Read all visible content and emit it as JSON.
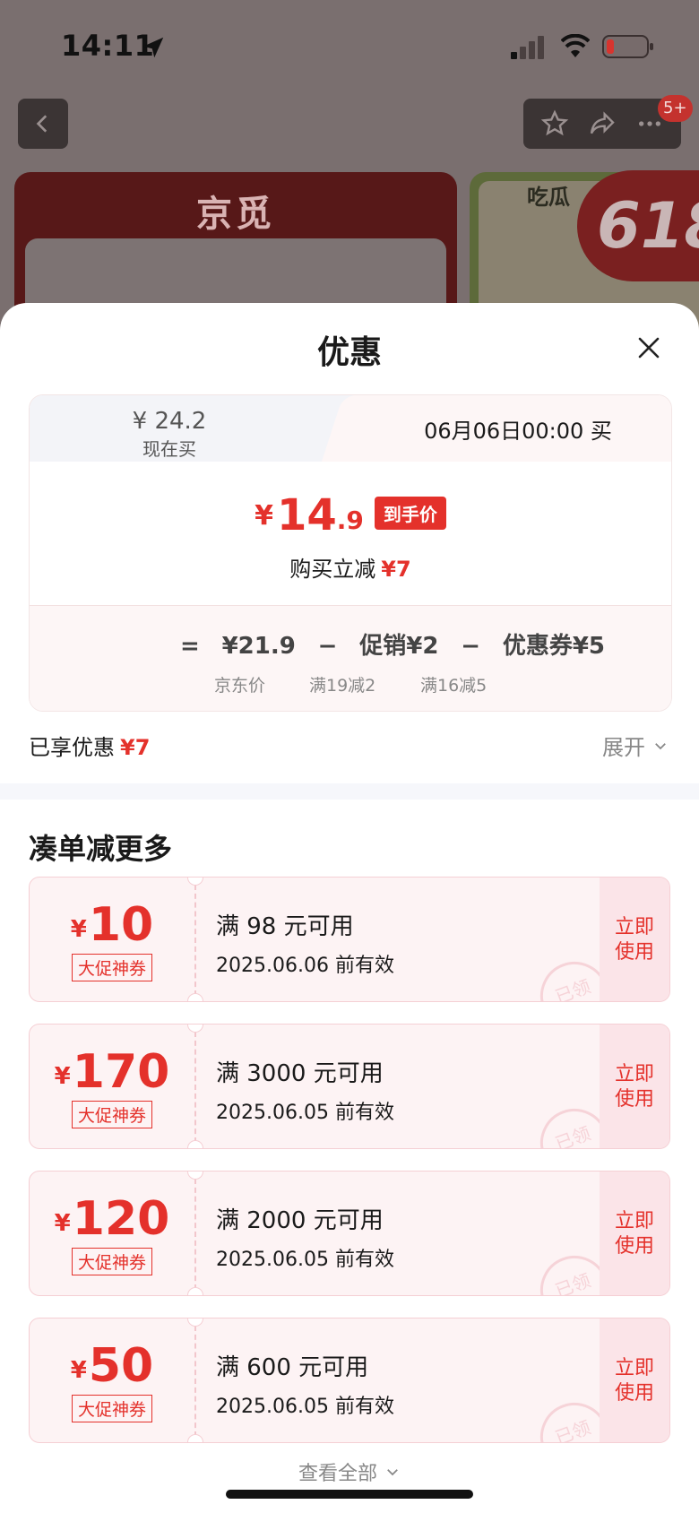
{
  "status_bar": {
    "time": "14:11"
  },
  "background": {
    "brand": "京觅",
    "badge": "5+",
    "promo": "618",
    "side_card_title": "吃瓜"
  },
  "sheet": {
    "title": "优惠",
    "now_tab": {
      "price": "¥ 24.2",
      "label": "现在买"
    },
    "future_tab": {
      "label": "06月06日00:00 买"
    },
    "final": {
      "yen": "¥",
      "int": "14",
      "dec": ".9",
      "tag": "到手价"
    },
    "cut": {
      "label": "购买立减",
      "amount": "¥7"
    },
    "formula": {
      "equals": "=",
      "jd_price": "¥21.9",
      "minus1": "−",
      "promo": "促销¥2",
      "minus2": "−",
      "coupon": "优惠券¥5",
      "jd_price_label": "京东价",
      "promo_label": "满19减2",
      "coupon_label": "满16减5"
    },
    "enjoyed": {
      "label": "已享优惠",
      "amount": "¥7"
    },
    "expand_label": "展开",
    "section_title": "凑单减更多",
    "coupons": [
      {
        "yen": "¥",
        "amount": "10",
        "type": "大促神券",
        "condition": "满 98 元可用",
        "valid": "2025.06.06 前有效",
        "action": "立即使用",
        "stamp": "已领"
      },
      {
        "yen": "¥",
        "amount": "170",
        "type": "大促神券",
        "condition": "满 3000 元可用",
        "valid": "2025.06.05 前有效",
        "action": "立即使用",
        "stamp": "已领"
      },
      {
        "yen": "¥",
        "amount": "120",
        "type": "大促神券",
        "condition": "满 2000 元可用",
        "valid": "2025.06.05 前有效",
        "action": "立即使用",
        "stamp": "已领"
      },
      {
        "yen": "¥",
        "amount": "50",
        "type": "大促神券",
        "condition": "满 600 元可用",
        "valid": "2025.06.05 前有效",
        "action": "立即使用",
        "stamp": "已领"
      }
    ],
    "view_all": "查看全部"
  },
  "colors": {
    "accent": "#e4312b",
    "coupon_bg": "#fdf3f4"
  }
}
